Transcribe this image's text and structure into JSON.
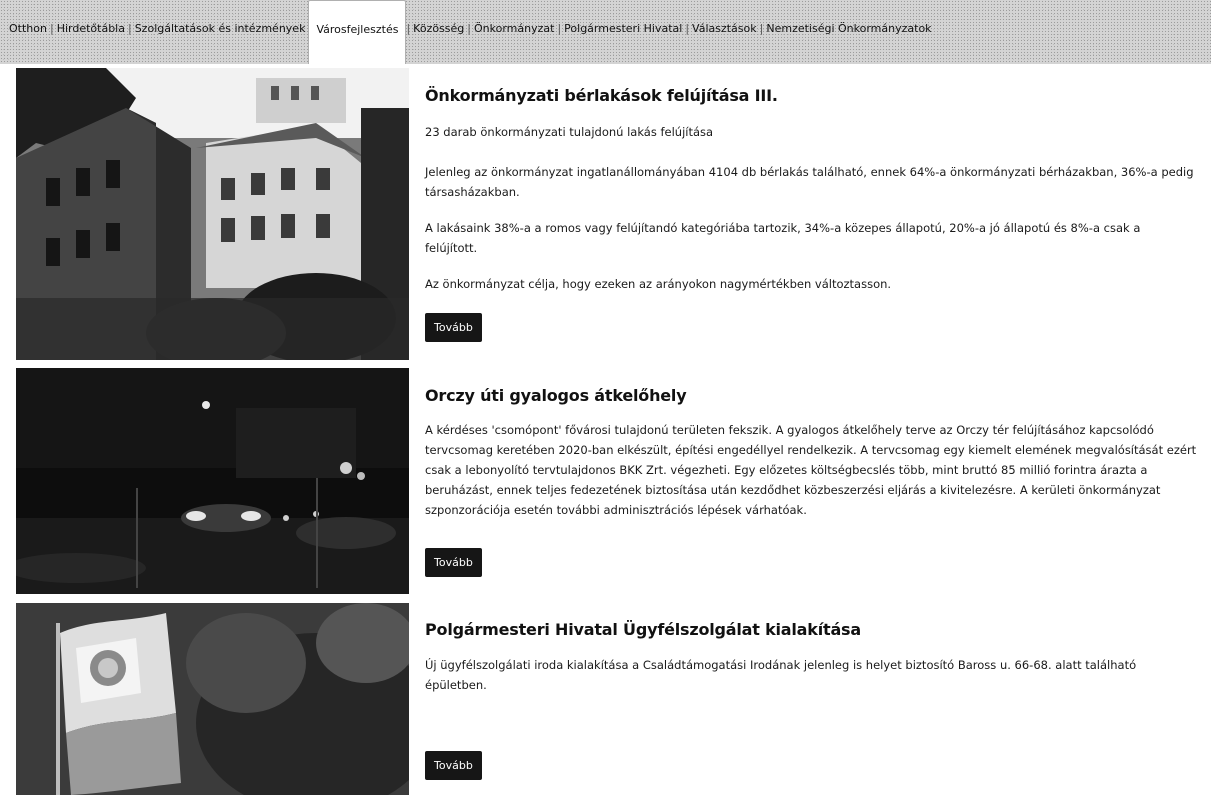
{
  "nav": {
    "items": [
      {
        "label": "Otthon"
      },
      {
        "label": "Hirdetőtábla"
      },
      {
        "label": "Szolgáltatások és intézmények"
      },
      {
        "label": "Városfejlesztés"
      },
      {
        "label": "Közösség"
      },
      {
        "label": "Önkormányzat"
      },
      {
        "label": "Polgármesteri Hivatal"
      },
      {
        "label": "Választások"
      },
      {
        "label": "Nemzetiségi Önkormányzatok"
      }
    ],
    "active_index": 3
  },
  "articles": [
    {
      "title": "Önkormányzati bérlakások felújítása III.",
      "paragraphs": [
        "23 darab önkormányzati tulajdonú lakás felújítása",
        "Jelenleg az önkormányzat ingatlanállományában 4104 db bérlakás található, ennek 64%-a önkormányzati bérházakban, 36%-a pedig társasházakban.",
        "A lakásaink 38%-a a romos vagy felújítandó kategóriába tartozik, 34%-a közepes állapotú, 20%-a jó állapotú és 8%-a csak a felújított.",
        "Az önkormányzat célja, hogy ezeken az arányokon nagymértékben változtasson."
      ],
      "button": "Tovább"
    },
    {
      "title": "Orczy úti gyalogos átkelőhely",
      "paragraphs": [
        "A kérdéses 'csomópont' fővárosi tulajdonú területen fekszik. A gyalogos átkelőhely terve az Orczy tér felújításához kapcsolódó tervcsomag keretében 2020-ban elkészült, építési engedéllyel rendelkezik.  A tervcsomag egy kiemelt elemének megvalósítását ezért csak a lebonyolító tervtulajdonos BKK Zrt. végezheti. Egy előzetes költségbecslés több, mint bruttó 85 millió forintra árazta a beruházást, ennek teljes fedezetének biztosítása után kezdődhet közbeszerzési eljárás a kivitelezésre. A kerületi önkormányzat szponzorációja esetén további adminisztrációs lépések várhatóak."
      ],
      "button": "Tovább"
    },
    {
      "title": "Polgármesteri Hivatal Ügyfélszolgálat kialakítása",
      "paragraphs": [
        "Új ügyfélszolgálati iroda kialakítása a Családtámogatási Irodának jelenleg is helyet biztosító Baross u. 66-68. alatt található épületben."
      ],
      "button": "Tovább"
    }
  ]
}
